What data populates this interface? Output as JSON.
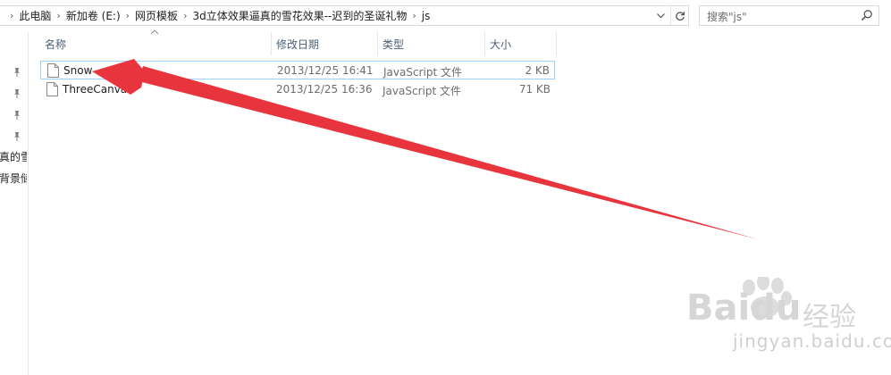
{
  "breadcrumb": [
    "此电脑",
    "新加卷 (E:)",
    "网页模板",
    "3d立体效果逼真的雪花效果--迟到的圣诞礼物",
    "js"
  ],
  "search": {
    "placeholder": "搜索\"js\""
  },
  "nav": {
    "items": [
      "真的雪",
      "背景储"
    ]
  },
  "columns": {
    "name": "名称",
    "date": "修改日期",
    "type": "类型",
    "size": "大小"
  },
  "files": [
    {
      "name": "Snow",
      "date": "2013/12/25 16:41",
      "type": "JavaScript 文件",
      "size": "2 KB",
      "selected": true
    },
    {
      "name": "ThreeCanvas",
      "date": "2013/12/25 16:36",
      "type": "JavaScript 文件",
      "size": "71 KB",
      "selected": false
    }
  ],
  "watermark": {
    "logo": "Baidu",
    "suffix": "经验",
    "url": "jingyan.baidu.com"
  },
  "colors": {
    "annotation": "#e8353d",
    "selection_border": "#99d1ff",
    "header_text": "#4c607a"
  }
}
